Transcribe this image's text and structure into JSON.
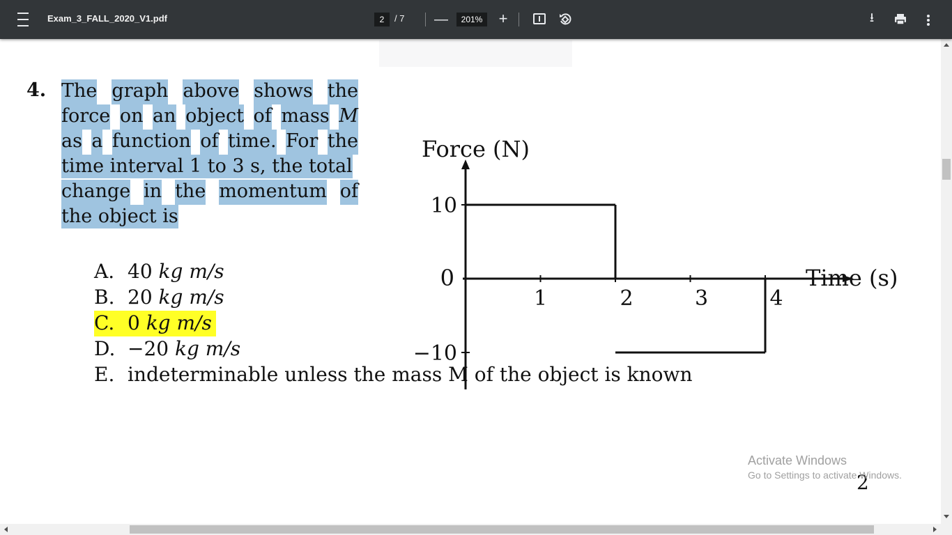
{
  "toolbar": {
    "title": "Exam_3_FALL_2020_V1.pdf",
    "page_current": "2",
    "page_total": "/ 7",
    "zoom": "201%",
    "zoom_out_label": "—",
    "zoom_in_label": "+",
    "download_glyph": "⭳",
    "icons": [
      "menu-icon",
      "fit-page-icon",
      "rotate-icon",
      "download-icon",
      "print-icon",
      "more-vert-icon"
    ]
  },
  "question": {
    "number": "4.",
    "lines": [
      [
        "The",
        "graph",
        "above",
        "shows",
        "the"
      ],
      [
        "force",
        "on",
        "an",
        "object",
        "of",
        "mass",
        "M"
      ],
      [
        "as",
        "a",
        "function",
        "of",
        "time.",
        "For",
        "the"
      ],
      [
        "time interval 1 to 3 s, the total"
      ],
      [
        "change",
        "in",
        "the",
        "momentum",
        "of"
      ],
      [
        "the object is"
      ]
    ]
  },
  "answers": [
    {
      "letter": "A.",
      "value": "40 ",
      "unit": "kg m/s",
      "highlight": false
    },
    {
      "letter": "B.",
      "value": "20 ",
      "unit": "kg m/s",
      "highlight": false
    },
    {
      "letter": "C.",
      "value": "0 ",
      "unit": "kg m/s",
      "highlight": true
    },
    {
      "letter": "D.",
      "value": "−20 ",
      "unit": "kg m/s",
      "highlight": false
    },
    {
      "letter": "E.",
      "value": "indeterminable unless the mass M of the object is known",
      "unit": "",
      "highlight": false
    }
  ],
  "graph": {
    "ylabel": "Force (N)",
    "xlabel": "Time (s)",
    "origin_label": "0",
    "yticks": [
      10,
      -10
    ],
    "ytick_labels": [
      "10",
      "−10"
    ],
    "xticks": [
      1,
      2,
      3,
      4
    ],
    "xtick_labels": [
      "1",
      "2",
      "3",
      "4"
    ],
    "segments": [
      {
        "t_start": 0,
        "t_end": 2,
        "force": 10
      },
      {
        "t_start": 2,
        "t_end": 4,
        "force": -10
      }
    ]
  },
  "page_number": "2",
  "watermark": {
    "title": "Activate Windows",
    "subtitle": "Go to Settings to activate Windows."
  },
  "colors": {
    "toolbar_bg": "#323639",
    "selection_highlight": "#9fc4e0",
    "answer_highlight": "#ffff26"
  }
}
